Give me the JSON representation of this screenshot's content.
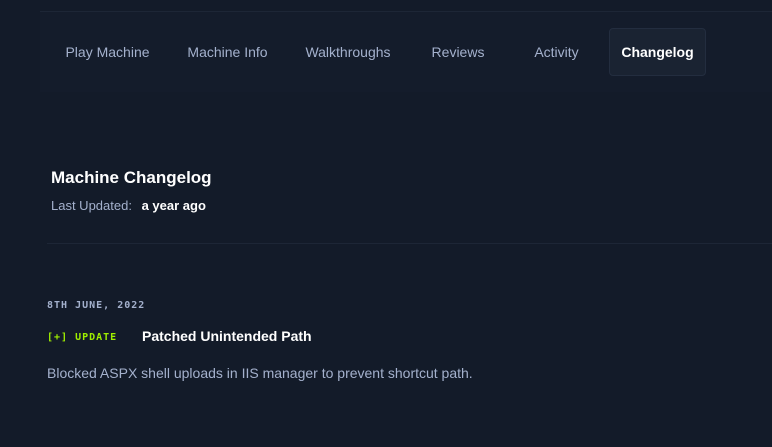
{
  "nav": {
    "tabs": [
      {
        "label": "Play Machine",
        "active": false
      },
      {
        "label": "Machine Info",
        "active": false
      },
      {
        "label": "Walkthroughs",
        "active": false
      },
      {
        "label": "Reviews",
        "active": false
      },
      {
        "label": "Activity",
        "active": false
      },
      {
        "label": "Changelog",
        "active": true
      }
    ]
  },
  "changelog": {
    "title": "Machine Changelog",
    "last_updated_label": "Last Updated:",
    "last_updated_value": "a year ago",
    "entries": [
      {
        "date": "8TH JUNE, 2022",
        "tag": "[+] UPDATE",
        "title": "Patched Unintended Path",
        "description": "Blocked ASPX shell uploads in IIS manager to prevent shortcut path."
      }
    ]
  },
  "colors": {
    "background": "#131b29",
    "navbar": "#141c2b",
    "text_muted": "#a4b1cd",
    "text_primary": "#ffffff",
    "accent_green": "#9fef00"
  }
}
